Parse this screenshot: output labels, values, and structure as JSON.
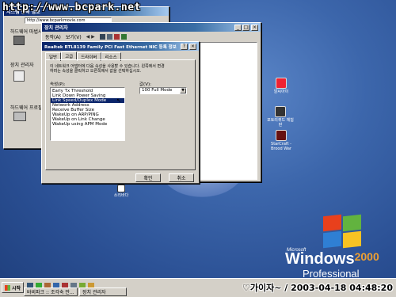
{
  "watermark": "http://www.bcpark.net",
  "win1": {
    "title_frag1": "하드웨어 마법사",
    "title_frag2": "시스템 등록 정보",
    "address": "http://www.bcparkmovie.com",
    "group1_label": "하드웨어 마법사",
    "group2_label": "장치 관리자",
    "group3_label": "하드웨어 프로필"
  },
  "win2": {
    "title": "장치 관리자",
    "menu": [
      "동작(A)",
      "보기(V)"
    ]
  },
  "dialog": {
    "title": "Realtek RTL8139 Family PCI Fast Ethernet NIC 등록 정보",
    "tabs": [
      "일반",
      "고급",
      "드라이버",
      "리소스"
    ],
    "description": "이 네트워크 어댑터에 다음 속성을 사용할 수 있습니다. 왼쪽에서 변경\n하려는 속성을 클릭하고 오른쪽에서 값을 선택하십시오.",
    "property_label": "속성(P):",
    "value_label": "값(V):",
    "properties": [
      "Early Tx Threshold",
      "Link Down Power Saving",
      "Link Speed/Duplex Mode",
      "Network Address",
      "Receive Buffer Size",
      "WakeUp on ARP/PING",
      "WakeUp on Link Change",
      "WakeUp using APM Mode"
    ],
    "selected_index": 2,
    "value": "100 Full Mode",
    "ok": "확인",
    "cancel": "취소"
  },
  "desktop_icons": [
    {
      "label": "알씨아이"
    },
    {
      "label": "포토리퀴드 체험판"
    },
    {
      "label": "StarCraft - Brood War"
    },
    {
      "label": "소리바다"
    }
  ],
  "logo": {
    "microsoft": "Microsoft",
    "windows": "Windows",
    "version": "2000",
    "edition": "Professional"
  },
  "taskbar": {
    "start": "시작",
    "tasks": [
      "바비파크 :: 조각숙 만...",
      "장치 관리자"
    ],
    "clock_overlay": "♡가이자~ / 2003-04-18 04:48:20"
  }
}
